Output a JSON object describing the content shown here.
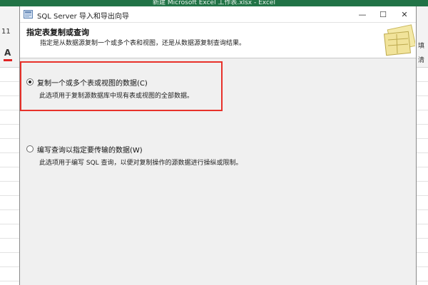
{
  "excel": {
    "title": "新建 Microsoft Excel 工作表.xlsx - Excel",
    "font_size": "11",
    "font_color_glyph": "A",
    "fill_label": "填",
    "clear_label": "清",
    "accent_color": "#217346"
  },
  "dialog": {
    "title": "SQL Server 导入和导出向导",
    "minimize_glyph": "—",
    "maximize_glyph": "☐",
    "close_glyph": "✕",
    "header_title": "指定表复制或查询",
    "header_subtitle": "指定是从数据源复制一个或多个表和视图，还是从数据源复制查询结果。",
    "options": [
      {
        "label": "复制一个或多个表或视图的数据(C)",
        "description": "此选项用于复制源数据库中现有表或视图的全部数据。",
        "selected": true
      },
      {
        "label": "编写查询以指定要传输的数据(W)",
        "description": "此选项用于编写 SQL 查询，以便对复制操作的源数据进行操纵或限制。",
        "selected": false
      }
    ],
    "highlight_color": "#e8312a"
  }
}
